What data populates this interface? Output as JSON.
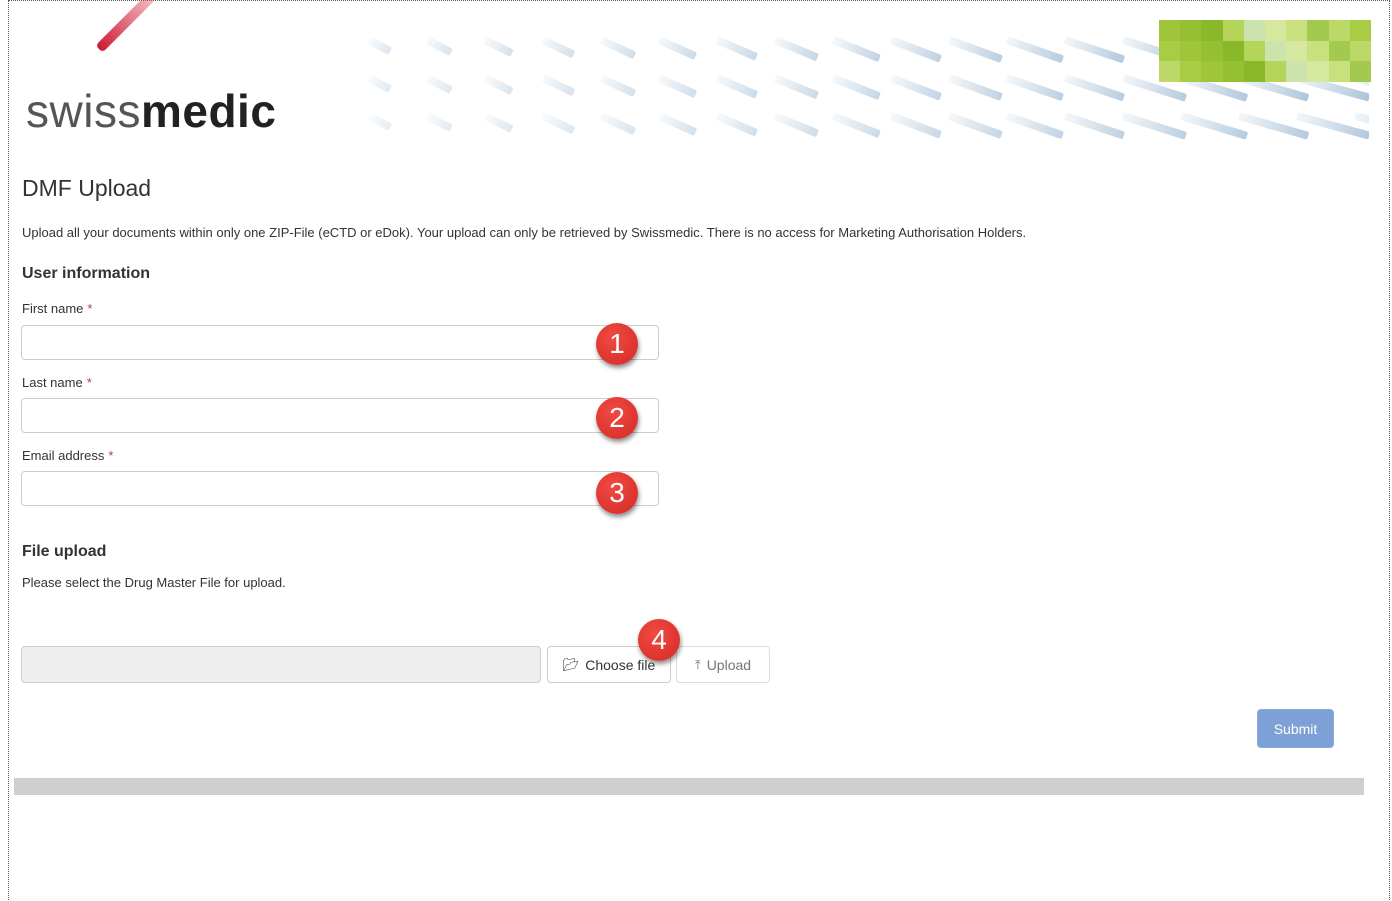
{
  "header": {
    "logo": {
      "part_light": "swiss",
      "part_bold": "medic"
    },
    "accent_color": "#d40f2a"
  },
  "form": {
    "page_title": "DMF Upload",
    "intro": "Upload all your documents within only one ZIP-File (eCTD or eDok). Your upload can only be retrieved by Swissmedic. There is no access for Marketing Authorisation Holders.",
    "user_section_title": "User information",
    "fields": [
      {
        "label": "First name",
        "required_marker": "*",
        "value": "",
        "placeholder": ""
      },
      {
        "label": "Last name",
        "required_marker": "*",
        "value": "",
        "placeholder": ""
      },
      {
        "label": "Email address",
        "required_marker": "*",
        "value": "",
        "placeholder": ""
      }
    ],
    "file_section_title": "File upload",
    "file_hint": "Please select the Drug Master File for upload.",
    "file_value": "",
    "choose_button": {
      "label": "Choose file",
      "icon": "folder-open-icon"
    },
    "upload_button": {
      "label": "Upload",
      "icon": "upload-icon",
      "state": "disabled"
    },
    "submit_button": {
      "label": "Submit",
      "color": "#7da0d6"
    }
  },
  "callouts": [
    "1",
    "2",
    "3",
    "4"
  ],
  "colors": {
    "badge": "#e0342e",
    "required": "#a94442",
    "footer_bar": "#cfcfcf"
  }
}
